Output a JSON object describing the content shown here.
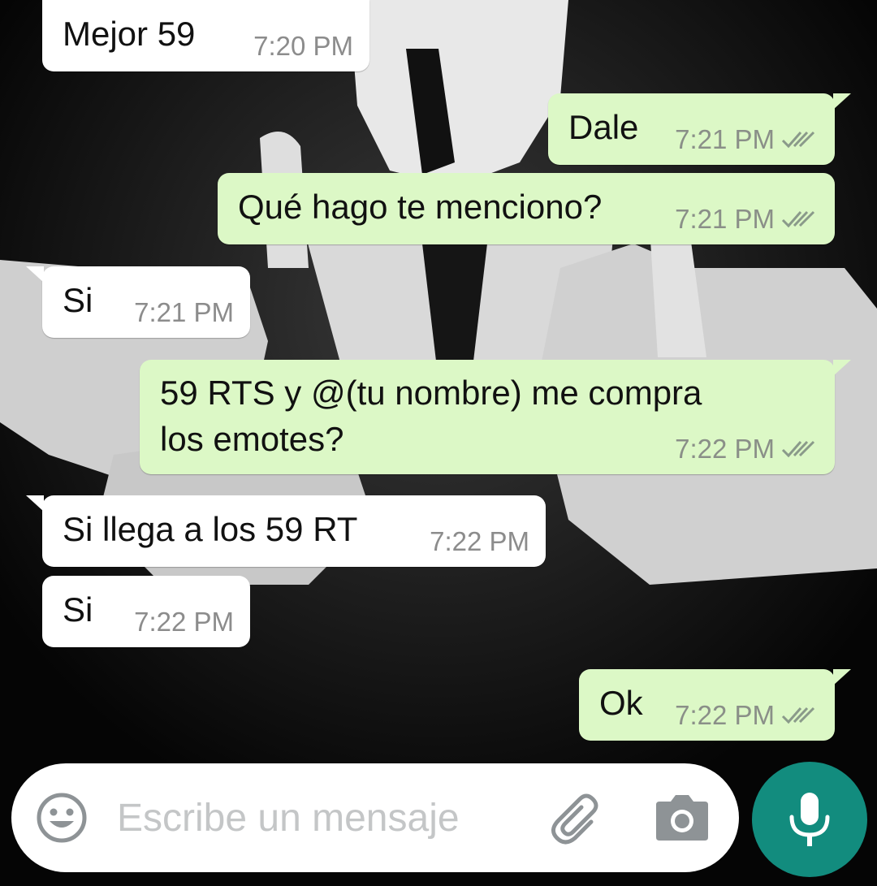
{
  "messages": [
    {
      "id": "m1",
      "direction": "in",
      "lines": [
        "Mejor 59"
      ],
      "time": "7:20 PM"
    },
    {
      "id": "m2",
      "direction": "out",
      "lines": [
        "Dale"
      ],
      "time": "7:21 PM",
      "status": "read"
    },
    {
      "id": "m3",
      "direction": "out",
      "lines": [
        "Qué hago te menciono?"
      ],
      "time": "7:21 PM",
      "status": "read"
    },
    {
      "id": "m4",
      "direction": "in",
      "lines": [
        "Si"
      ],
      "time": "7:21 PM"
    },
    {
      "id": "m5",
      "direction": "out",
      "lines": [
        "59 RTS y @(tu nombre) me compra",
        "los emotes?"
      ],
      "time": "7:22 PM",
      "status": "read"
    },
    {
      "id": "m6",
      "direction": "in",
      "lines": [
        "Si llega a los 59 RT"
      ],
      "time": "7:22 PM"
    },
    {
      "id": "m7",
      "direction": "in",
      "lines": [
        "Si"
      ],
      "time": "7:22 PM"
    },
    {
      "id": "m8",
      "direction": "out",
      "lines": [
        "Ok"
      ],
      "time": "7:22 PM",
      "status": "read"
    }
  ],
  "composer": {
    "placeholder": "Escribe un mensaje",
    "emoji_icon": "smiley-icon",
    "attach_icon": "paperclip-icon",
    "camera_icon": "camera-icon",
    "mic_icon": "microphone-icon"
  },
  "colors": {
    "incoming_bubble": "#ffffff",
    "outgoing_bubble": "#dcf8c6",
    "mic_button": "#128c7e",
    "time_text": "#8c8c8c"
  }
}
